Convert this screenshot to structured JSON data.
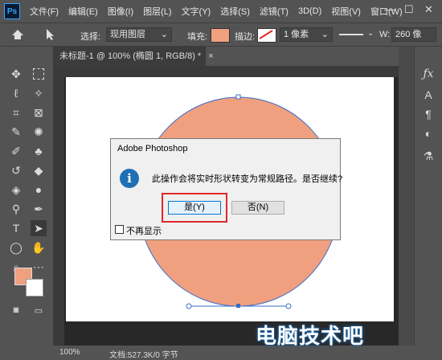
{
  "menu": {
    "logo": "Ps",
    "items": [
      "文件(F)",
      "编辑(E)",
      "图像(I)",
      "图层(L)",
      "文字(Y)",
      "选择(S)",
      "滤镜(T)",
      "3D(D)",
      "视图(V)",
      "窗口(W)"
    ],
    "window_controls": [
      "—",
      "☐",
      "✕"
    ]
  },
  "options": {
    "select_label": "选择:",
    "select_value": "现用图层",
    "fill_label": "填充:",
    "fill_color": "#f0a07e",
    "stroke_label": "描边:",
    "stroke_width": "1 像素",
    "w_label": "W:",
    "w_value": "260 像"
  },
  "document": {
    "tab_title": "未标题-1 @ 100% (椭圆 1, RGB/8) *",
    "close": "×",
    "shape_fill": "#f0a07e",
    "shape_stroke": "#3b6ec8"
  },
  "status": {
    "zoom": "100%",
    "doc_info": "文档:527.3K/0 字节"
  },
  "dialog": {
    "title": "Adobe Photoshop",
    "icon_glyph": "i",
    "message": "此操作会将实时形状转变为常规路径。是否继续?",
    "yes_label": "是(Y)",
    "no_label": "否(N)",
    "dont_show": "不再显示",
    "highlight_color": "#e0272b"
  },
  "tools": {
    "foreground": "#f0a07e",
    "background": "#ffffff"
  },
  "watermark": {
    "text": "电脑技术吧"
  }
}
